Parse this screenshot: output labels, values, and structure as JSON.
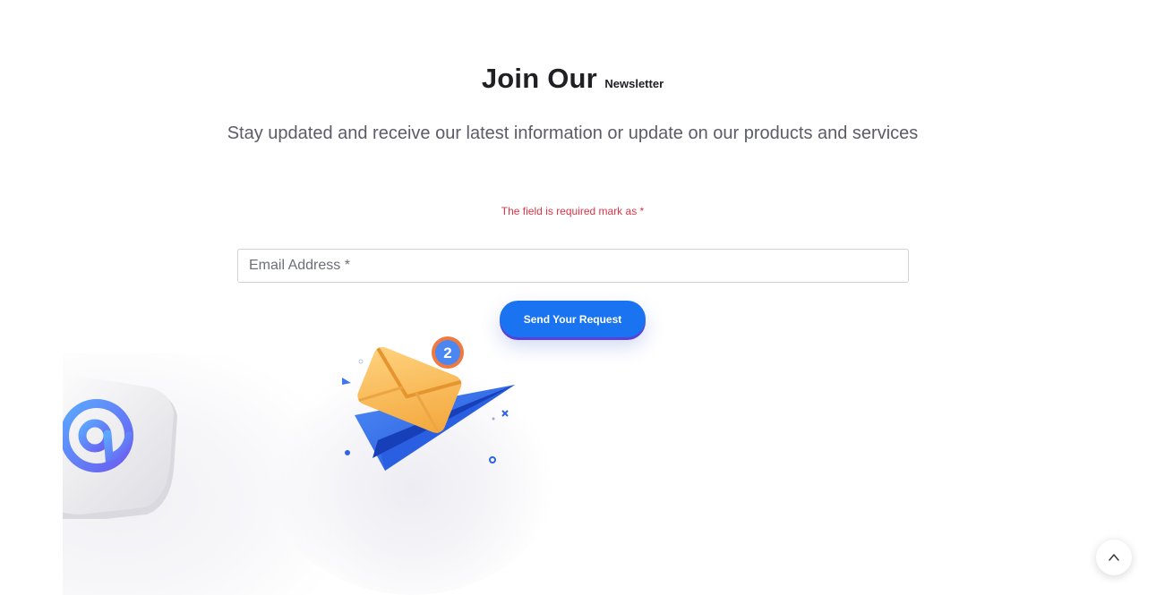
{
  "newsletter": {
    "title_main": "Join Our",
    "title_sub": "Newsletter",
    "subtitle": "Stay updated and receive our latest information or update on our products and services",
    "required_note": "The field is required mark as *"
  },
  "form": {
    "email_placeholder": "Email Address *",
    "email_value": "",
    "submit_label": "Send Your Request"
  },
  "illustration": {
    "badge_count": "2"
  },
  "icons": {
    "scroll_top": "chevron-up-icon",
    "at_sign": "at-sign-icon",
    "envelope": "envelope-icon",
    "paper_plane": "paper-plane-icon"
  },
  "colors": {
    "accent": "#1a73f0",
    "required": "#dc3545",
    "envelope": "#f6b54f",
    "plane": "#2f63e6"
  }
}
